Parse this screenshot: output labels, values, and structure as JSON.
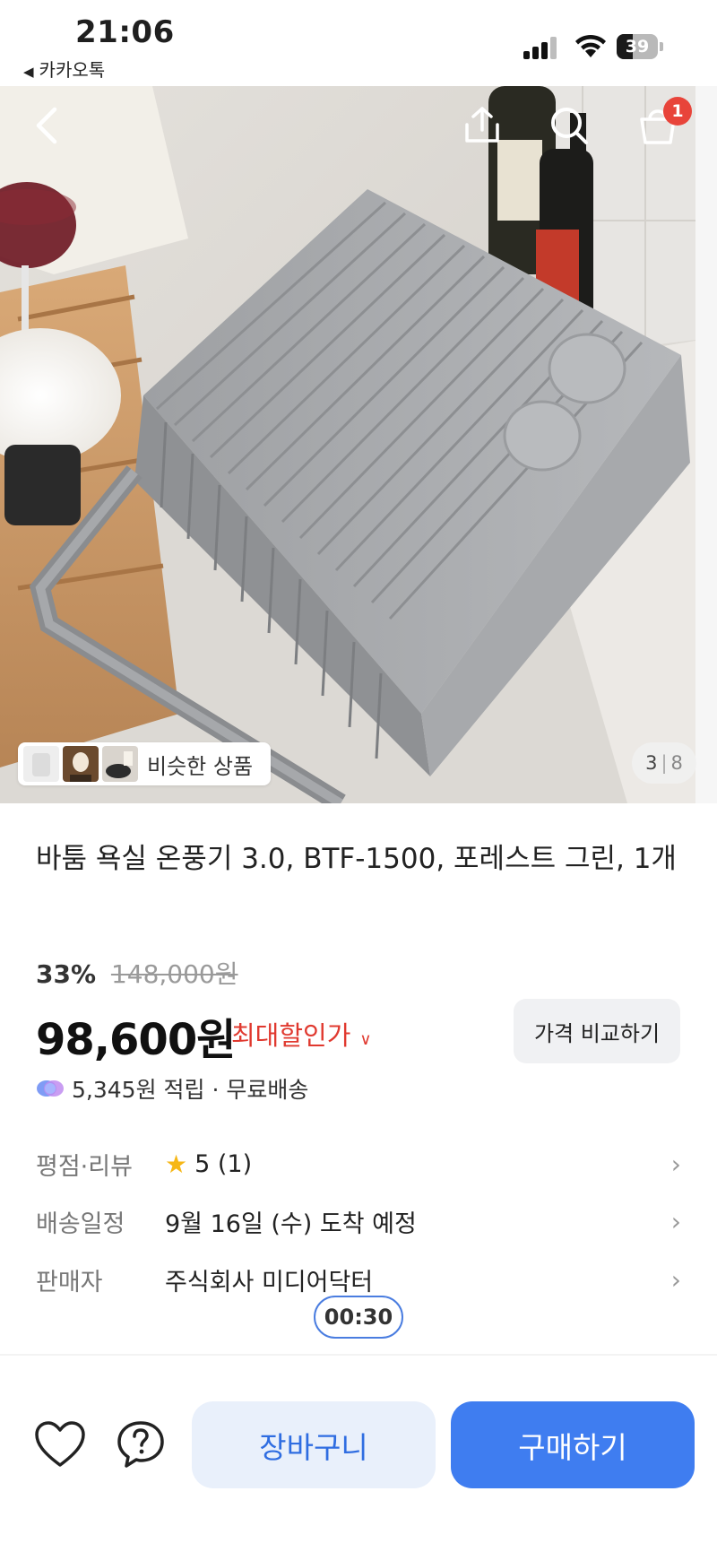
{
  "status_bar": {
    "time": "21:06",
    "back_app": "카카오톡",
    "battery": "39"
  },
  "hero": {
    "cart_count": "1",
    "similar_label": "비슷한 상품",
    "page_current": "3",
    "page_total": "8"
  },
  "product": {
    "title": "바툼 욕실 온풍기 3.0, BTF-1500, 포레스트 그린, 1개",
    "discount_percent": "33%",
    "original_price": "148,000원",
    "price": "98,600원",
    "max_discount_label": "최대할인가",
    "compare_label": "가격 비교하기",
    "points_text": "5,345원 적립 · 무료배송"
  },
  "info": [
    {
      "key": "평점·리뷰",
      "value": "5 (1)"
    },
    {
      "key": "배송일정",
      "value": "9월 16일 (수) 도착 예정"
    },
    {
      "key": "판매자",
      "value": "주식회사 미디어닥터"
    }
  ],
  "timer": "00:30",
  "bottom_bar": {
    "cart_label": "장바구니",
    "buy_label": "구매하기"
  },
  "colors": {
    "accent": "#3f7df0",
    "discount_red": "#e0392f",
    "badge_red": "#e8443a",
    "star": "#f6b716"
  }
}
